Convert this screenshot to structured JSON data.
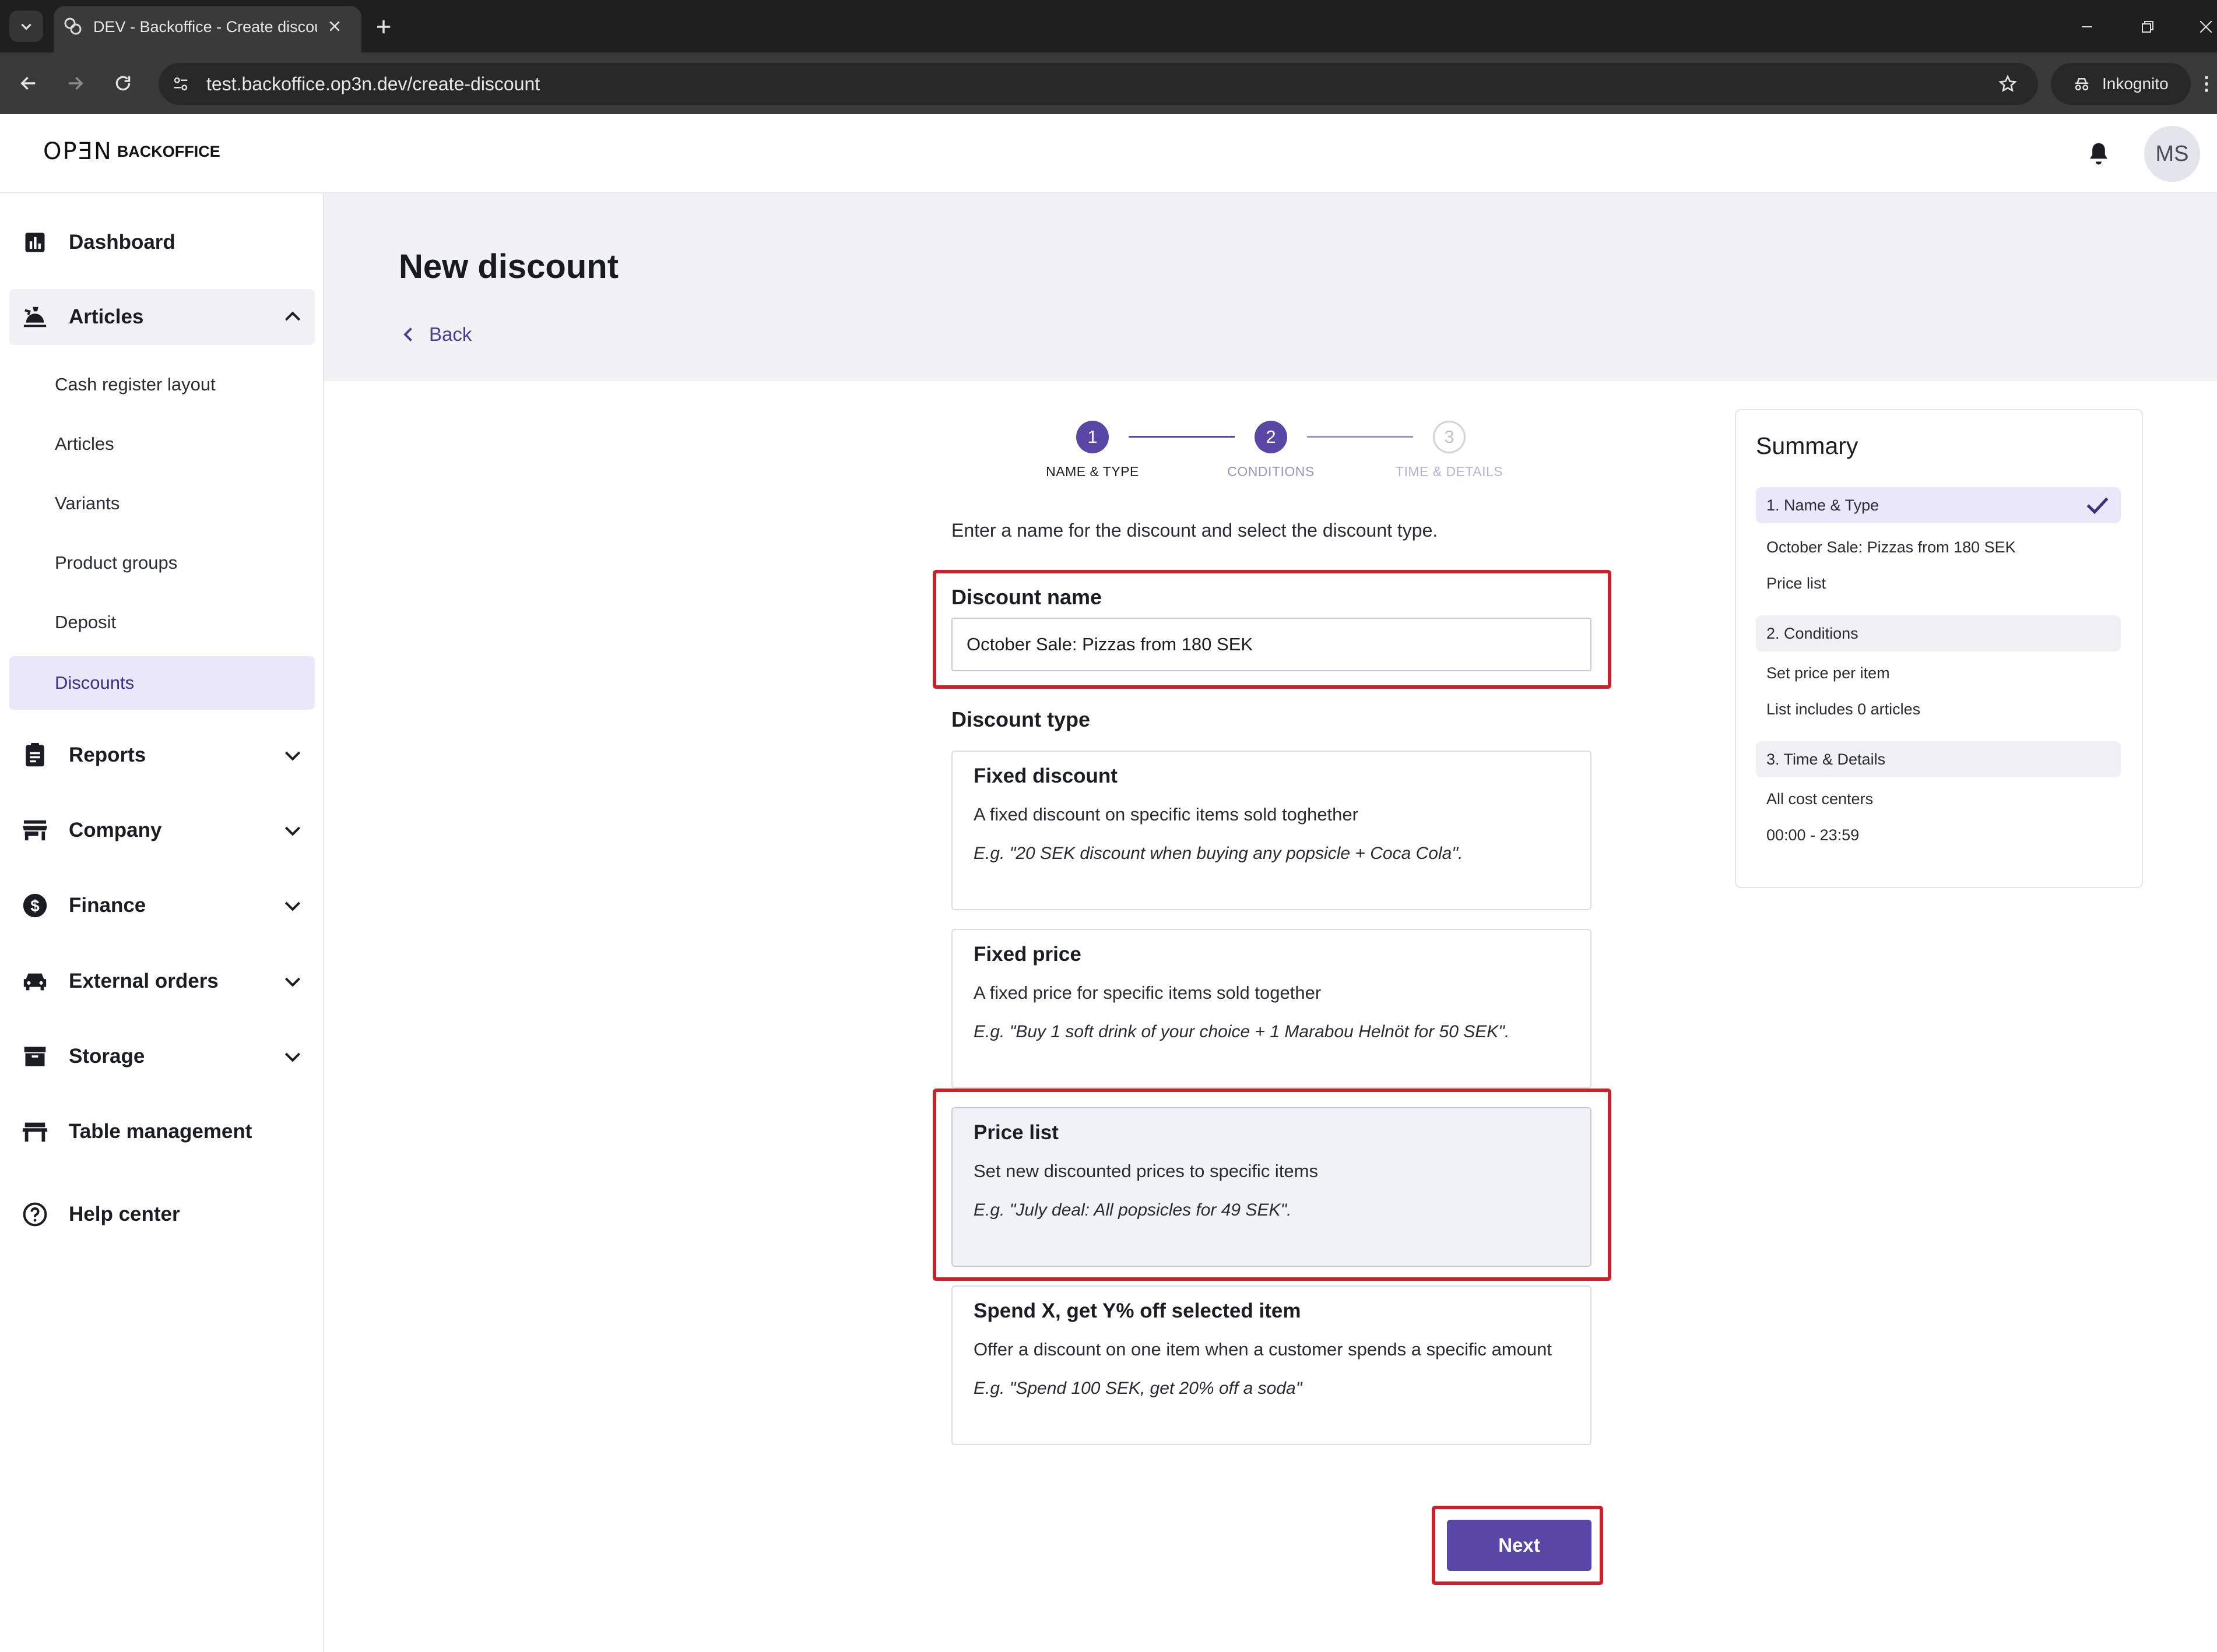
{
  "browser": {
    "tab_title": "DEV - Backoffice - Create discount",
    "url": "test.backoffice.op3n.dev/create-discount",
    "incognito_label": "Inkognito"
  },
  "header": {
    "logo_brand": "OPƎN",
    "logo_sub": "BACKOFFICE",
    "avatar_initials": "MS"
  },
  "sidebar": {
    "items": [
      {
        "label": "Dashboard",
        "icon": "bar-chart-icon"
      },
      {
        "label": "Articles",
        "icon": "food-tray-icon",
        "expanded": true
      },
      {
        "label": "Reports",
        "icon": "clipboard-icon"
      },
      {
        "label": "Company",
        "icon": "store-icon"
      },
      {
        "label": "Finance",
        "icon": "dollar-circle-icon"
      },
      {
        "label": "External orders",
        "icon": "car-icon"
      },
      {
        "label": "Storage",
        "icon": "archive-box-icon"
      },
      {
        "label": "Table management",
        "icon": "table-icon"
      },
      {
        "label": "Help center",
        "icon": "question-circle-icon"
      }
    ],
    "articles_sub": [
      "Cash register layout",
      "Articles",
      "Variants",
      "Product groups",
      "Deposit",
      "Discounts"
    ],
    "active_sub": "Discounts"
  },
  "page": {
    "title": "New discount",
    "back_label": "Back"
  },
  "stepper": {
    "steps": [
      {
        "number": "1",
        "label": "NAME & TYPE",
        "state": "current"
      },
      {
        "number": "2",
        "label": "CONDITIONS",
        "state": "done"
      },
      {
        "number": "3",
        "label": "TIME & DETAILS",
        "state": "todo"
      }
    ]
  },
  "form": {
    "intro": "Enter a name for the discount and select the discount type.",
    "name_label": "Discount name",
    "name_value": "October Sale: Pizzas from 180 SEK",
    "type_label": "Discount type",
    "types": [
      {
        "title": "Fixed discount",
        "description": "A fixed discount on specific items sold toghether",
        "example": "E.g. \"20 SEK discount when buying any popsicle + Coca Cola\"."
      },
      {
        "title": "Fixed price",
        "description": "A fixed price for specific items sold together",
        "example": "E.g. \"Buy 1 soft drink of your choice + 1 Marabou Helnöt for 50 SEK\"."
      },
      {
        "title": "Price list",
        "description": "Set new discounted prices to specific items",
        "example": "E.g. \"July deal: All popsicles for 49 SEK\".",
        "selected": true
      },
      {
        "title": "Spend X, get Y% off selected item",
        "description": "Offer a discount on one item when a customer spends a specific amount",
        "example": "E.g. \"Spend 100 SEK, get 20% off a soda\""
      }
    ],
    "next_label": "Next"
  },
  "summary": {
    "title": "Summary",
    "sections": [
      {
        "label": "1. Name & Type",
        "lines": [
          "October Sale: Pizzas from 180 SEK",
          "Price list"
        ],
        "complete": true
      },
      {
        "label": "2. Conditions",
        "lines": [
          "Set price per item",
          "List includes 0 articles"
        ]
      },
      {
        "label": "3. Time & Details",
        "lines": [
          "All cost centers",
          "00:00 - 23:59"
        ]
      }
    ]
  },
  "colors": {
    "accent": "#5a46a4",
    "highlight": "#c8222a",
    "active_bg": "#ebe7fb"
  }
}
